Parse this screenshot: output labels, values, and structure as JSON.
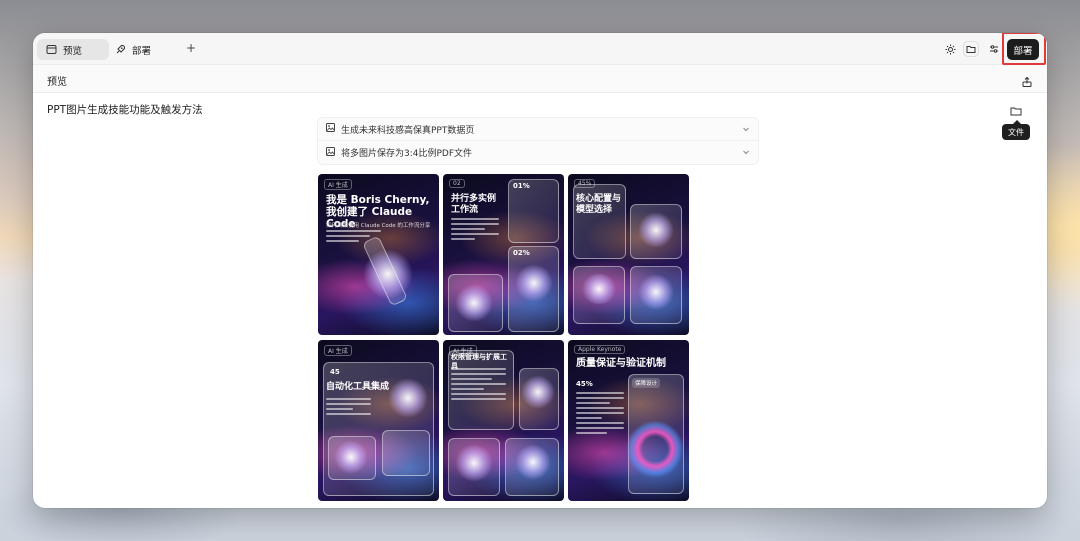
{
  "tabs": [
    {
      "label": "预览",
      "icon": "preview-window-icon"
    },
    {
      "label": "部署",
      "icon": "rocket-icon"
    }
  ],
  "new_tab_label": "+",
  "toolbar": {
    "deploy_label": "部署",
    "icons": [
      "theme-sun-icon",
      "folder-icon",
      "settings-sliders-icon"
    ]
  },
  "subheader": {
    "title": "预览"
  },
  "doc": {
    "title": "PPT图片生成技能功能及触发方法",
    "folder_tooltip": "文件"
  },
  "tasks": [
    {
      "label": "生成未来科技感高保真PPT数据页",
      "icon": "image-icon"
    },
    {
      "label": "将多图片保存为3:4比例PDF文件",
      "icon": "image-icon"
    }
  ],
  "slides": [
    {
      "tag": "AI 生成",
      "title": "我是 Boris Cherny,我创建了 Claude Code",
      "sub": "如何高效使用 Claude Code 的工作流分享"
    },
    {
      "tag": "02",
      "title": "并行多实例工作流",
      "badge1": "01%",
      "badge2": "02%"
    },
    {
      "tag": "03",
      "title": "核心配置与模型选择",
      "badge": "45%"
    },
    {
      "tag": "AI 生成",
      "title": "自动化工具集成",
      "badge": "45"
    },
    {
      "tag": "AI 生成",
      "title": "权限管理与扩展工具"
    },
    {
      "tag": "Apple Keynote",
      "title": "质量保证与验证机制",
      "badge": "45%",
      "pill": "保障设计"
    }
  ],
  "colors": {
    "deploy_bg": "#1c1c1c",
    "highlight": "#e03a3a"
  }
}
